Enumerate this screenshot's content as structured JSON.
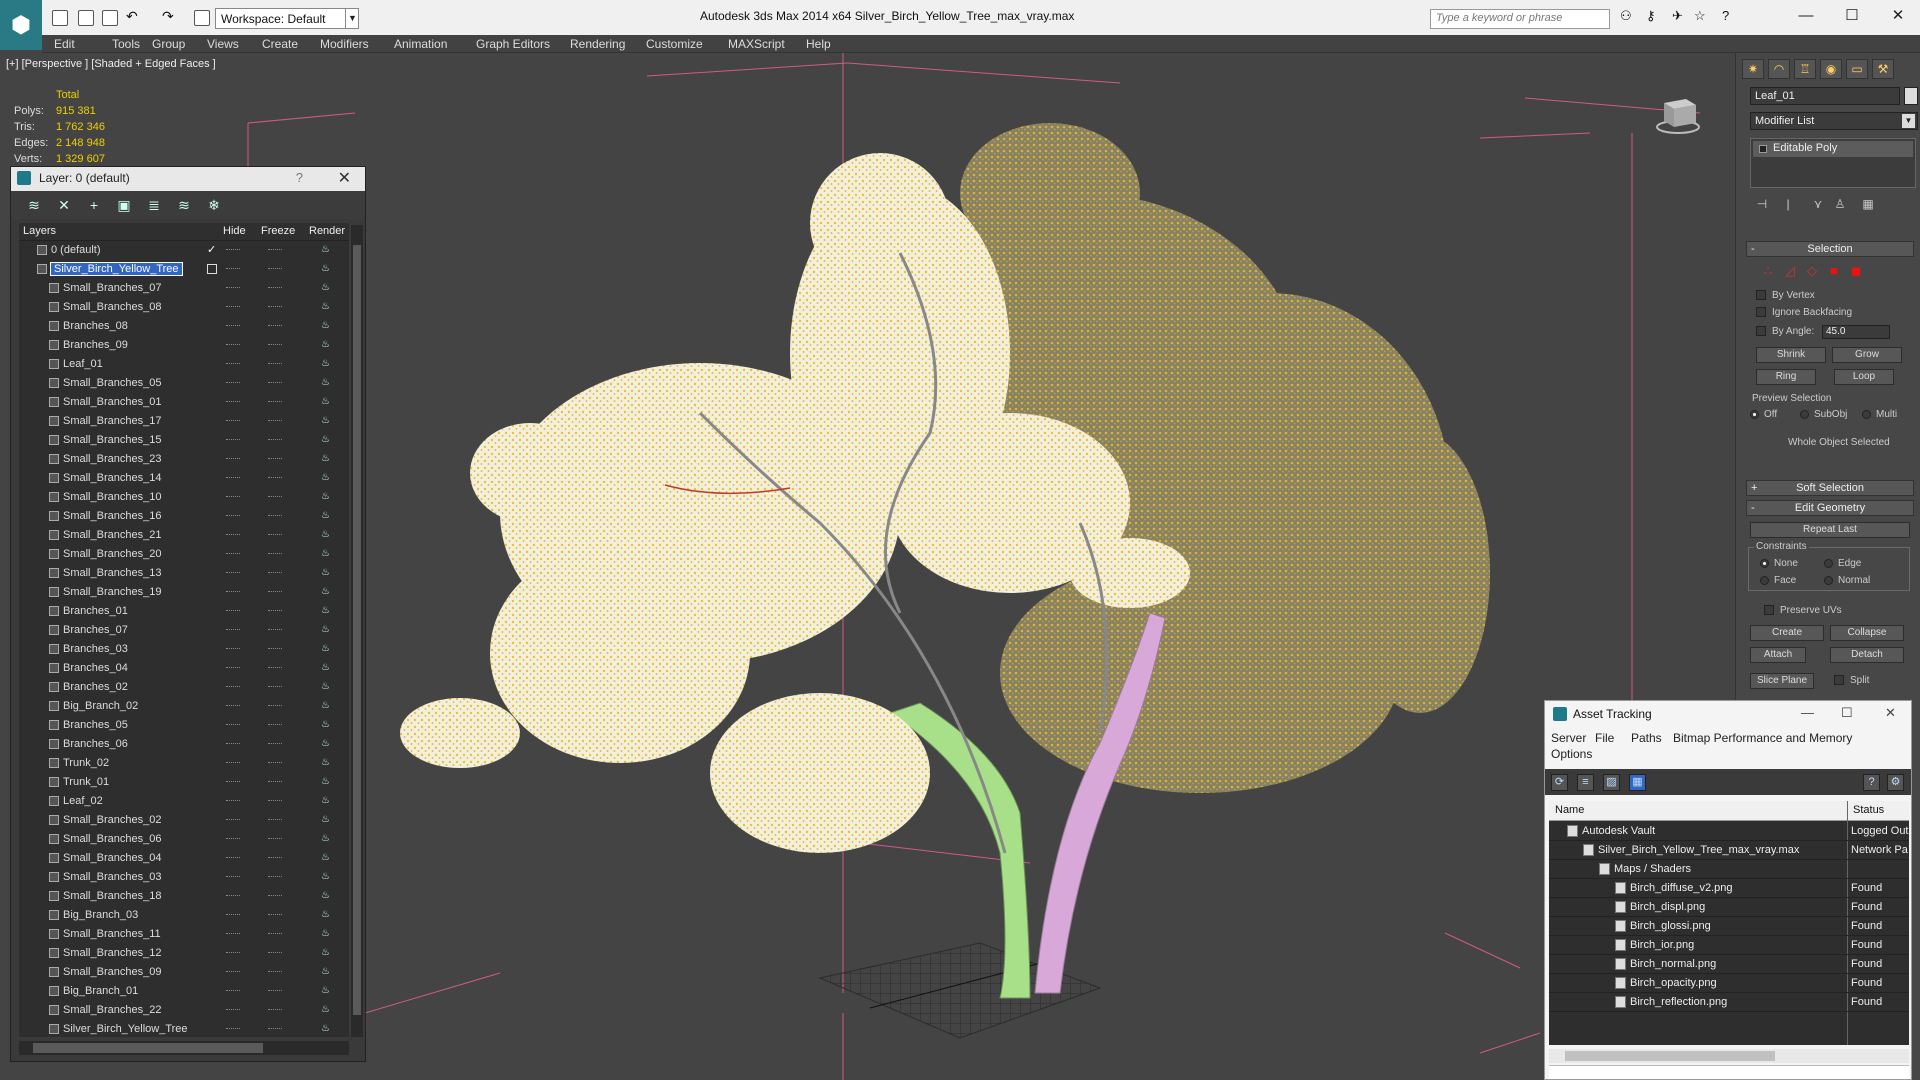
{
  "titlebar": {
    "title": "Autodesk 3ds Max  2014 x64      Silver_Birch_Yellow_Tree_max_vray.max",
    "workspace": "Workspace: Default",
    "search_placeholder": "Type a keyword or phrase"
  },
  "menu": [
    "Edit",
    "Tools",
    "Group",
    "Views",
    "Create",
    "Modifiers",
    "Animation",
    "Graph Editors",
    "Rendering",
    "Customize",
    "MAXScript",
    "Help"
  ],
  "viewport": {
    "label": "[+] [Perspective ] [Shaded + Edged Faces ]",
    "stats": {
      "header": "Total",
      "rows": [
        {
          "label": "Polys:",
          "value": "915 381"
        },
        {
          "label": "Tris:",
          "value": "1 762 346"
        },
        {
          "label": "Edges:",
          "value": "2 148 948"
        },
        {
          "label": "Verts:",
          "value": "1 329 607"
        }
      ]
    }
  },
  "layer_panel": {
    "title": "Layer: 0 (default)",
    "help": "?",
    "columns": {
      "layers": "Layers",
      "hide": "Hide",
      "freeze": "Freeze",
      "render": "Render"
    },
    "layers": [
      {
        "name": "0 (default)",
        "level": 0,
        "check": "✓"
      },
      {
        "name": "Silver_Birch_Yellow_Tree",
        "level": 0,
        "selected": true
      },
      {
        "name": "Small_Branches_07",
        "level": 1
      },
      {
        "name": "Small_Branches_08",
        "level": 1
      },
      {
        "name": "Branches_08",
        "level": 1
      },
      {
        "name": "Branches_09",
        "level": 1
      },
      {
        "name": "Leaf_01",
        "level": 1
      },
      {
        "name": "Small_Branches_05",
        "level": 1
      },
      {
        "name": "Small_Branches_01",
        "level": 1
      },
      {
        "name": "Small_Branches_17",
        "level": 1
      },
      {
        "name": "Small_Branches_15",
        "level": 1
      },
      {
        "name": "Small_Branches_23",
        "level": 1
      },
      {
        "name": "Small_Branches_14",
        "level": 1
      },
      {
        "name": "Small_Branches_10",
        "level": 1
      },
      {
        "name": "Small_Branches_16",
        "level": 1
      },
      {
        "name": "Small_Branches_21",
        "level": 1
      },
      {
        "name": "Small_Branches_20",
        "level": 1
      },
      {
        "name": "Small_Branches_13",
        "level": 1
      },
      {
        "name": "Small_Branches_19",
        "level": 1
      },
      {
        "name": "Branches_01",
        "level": 1
      },
      {
        "name": "Branches_07",
        "level": 1
      },
      {
        "name": "Branches_03",
        "level": 1
      },
      {
        "name": "Branches_04",
        "level": 1
      },
      {
        "name": "Branches_02",
        "level": 1
      },
      {
        "name": "Big_Branch_02",
        "level": 1
      },
      {
        "name": "Branches_05",
        "level": 1
      },
      {
        "name": "Branches_06",
        "level": 1
      },
      {
        "name": "Trunk_02",
        "level": 1
      },
      {
        "name": "Trunk_01",
        "level": 1
      },
      {
        "name": "Leaf_02",
        "level": 1
      },
      {
        "name": "Small_Branches_02",
        "level": 1
      },
      {
        "name": "Small_Branches_06",
        "level": 1
      },
      {
        "name": "Small_Branches_04",
        "level": 1
      },
      {
        "name": "Small_Branches_03",
        "level": 1
      },
      {
        "name": "Small_Branches_18",
        "level": 1
      },
      {
        "name": "Big_Branch_03",
        "level": 1
      },
      {
        "name": "Small_Branches_11",
        "level": 1
      },
      {
        "name": "Small_Branches_12",
        "level": 1
      },
      {
        "name": "Small_Branches_09",
        "level": 1
      },
      {
        "name": "Big_Branch_01",
        "level": 1
      },
      {
        "name": "Small_Branches_22",
        "level": 1
      },
      {
        "name": "Silver_Birch_Yellow_Tree",
        "level": 1
      }
    ]
  },
  "command_panel": {
    "object_name": "Leaf_01",
    "modifier_list": "Modifier List",
    "stack_item": "Editable Poly",
    "selection": {
      "title": "Selection",
      "by_vertex": "By Vertex",
      "ignore_backfacing": "Ignore Backfacing",
      "by_angle": "By Angle:",
      "angle_value": "45.0",
      "shrink": "Shrink",
      "grow": "Grow",
      "ring": "Ring",
      "loop": "Loop",
      "preview_selection": "Preview Selection",
      "off": "Off",
      "subobj": "SubObj",
      "multi": "Multi",
      "whole_object": "Whole Object Selected"
    },
    "soft_selection": "Soft Selection",
    "edit_geometry": {
      "title": "Edit Geometry",
      "repeat_last": "Repeat Last",
      "constraints": "Constraints",
      "none": "None",
      "edge": "Edge",
      "face": "Face",
      "normal": "Normal",
      "preserve_uvs": "Preserve UVs",
      "create": "Create",
      "collapse": "Collapse",
      "attach": "Attach",
      "detach": "Detach",
      "slice_plane": "Slice Plane",
      "split": "Split"
    }
  },
  "asset_panel": {
    "title": "Asset Tracking",
    "menus": [
      "Server",
      "File",
      "Paths",
      "Bitmap Performance and Memory",
      "Options"
    ],
    "columns": {
      "name": "Name",
      "status": "Status"
    },
    "rows": [
      {
        "name": "Autodesk Vault",
        "status": "Logged Out",
        "level": 0
      },
      {
        "name": "Silver_Birch_Yellow_Tree_max_vray.max",
        "status": "Network Pa",
        "level": 1
      },
      {
        "name": "Maps / Shaders",
        "status": "",
        "level": 2
      },
      {
        "name": "Birch_diffuse_v2.png",
        "status": "Found",
        "level": 3
      },
      {
        "name": "Birch_displ.png",
        "status": "Found",
        "level": 3
      },
      {
        "name": "Birch_glossi.png",
        "status": "Found",
        "level": 3
      },
      {
        "name": "Birch_ior.png",
        "status": "Found",
        "level": 3
      },
      {
        "name": "Birch_normal.png",
        "status": "Found",
        "level": 3
      },
      {
        "name": "Birch_opacity.png",
        "status": "Found",
        "level": 3
      },
      {
        "name": "Birch_reflection.png",
        "status": "Found",
        "level": 3
      }
    ]
  },
  "colors": {
    "viewport_bg": "#444444",
    "stats_value": "#f0d000",
    "selection_blue": "#3266c0",
    "trunk_green": "#a8e08a",
    "trunk_pink": "#d7a8d8",
    "leaf_white": "#f4efd8",
    "leaf_olive": "#b8aa72"
  }
}
